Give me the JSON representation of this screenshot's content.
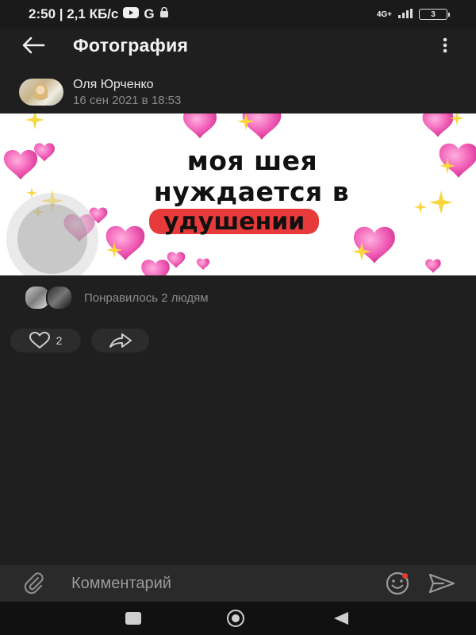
{
  "status_bar": {
    "time_speed": "2:50 | 2,1 КБ/с",
    "network": "4G+",
    "battery": "3"
  },
  "app_bar": {
    "title": "Фотография"
  },
  "post": {
    "author_name": "Оля Юрченко",
    "date": "16 сен 2021 в 18:53"
  },
  "photo": {
    "line1": "моя шея",
    "line2": "нуждается в",
    "line3": "удушении",
    "highlight_color": "#e83a3a"
  },
  "likes": {
    "text": "Понравилось 2 людям",
    "count": "2"
  },
  "comment": {
    "placeholder": "Комментарий"
  },
  "icons": {
    "back": "arrow-left-icon",
    "more": "more-vertical-icon",
    "like": "heart-outline-icon",
    "share": "share-arrow-icon",
    "attach": "paperclip-icon",
    "emoji": "smiley-icon",
    "send": "send-icon"
  },
  "colors": {
    "background": "#1f1f1f",
    "accent_red": "#e53935",
    "heart_pink": "#f05ab4",
    "sparkle_yellow": "#f7d640"
  }
}
